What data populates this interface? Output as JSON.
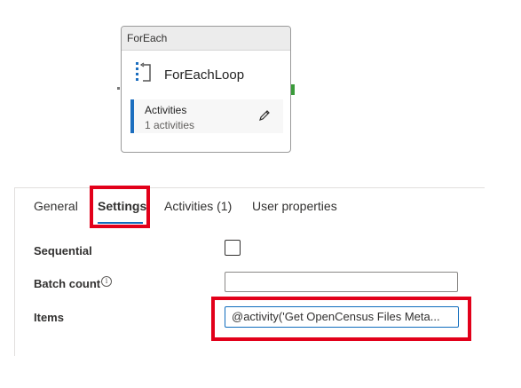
{
  "card": {
    "header": "ForEach",
    "name": "ForEachLoop",
    "activities_label": "Activities",
    "activities_count": "1 activities"
  },
  "tabs": [
    {
      "label": "General",
      "active": false
    },
    {
      "label": "Settings",
      "active": true
    },
    {
      "label": "Activities (1)",
      "active": false
    },
    {
      "label": "User properties",
      "active": false
    }
  ],
  "settings": {
    "sequential_label": "Sequential",
    "sequential_checked": false,
    "batch_count_label": "Batch count",
    "batch_count_value": "",
    "items_label": "Items",
    "items_value": "@activity('Get OpenCensus Files Meta..."
  },
  "colors": {
    "accent": "#0f6cbd",
    "highlight": "#e2001a",
    "activities_bar": "#1c6ebf",
    "success_connector": "#3a9b3a"
  },
  "icons": {
    "foreach": "foreach-loop-icon",
    "edit": "pencil-icon",
    "info": "info-icon"
  }
}
